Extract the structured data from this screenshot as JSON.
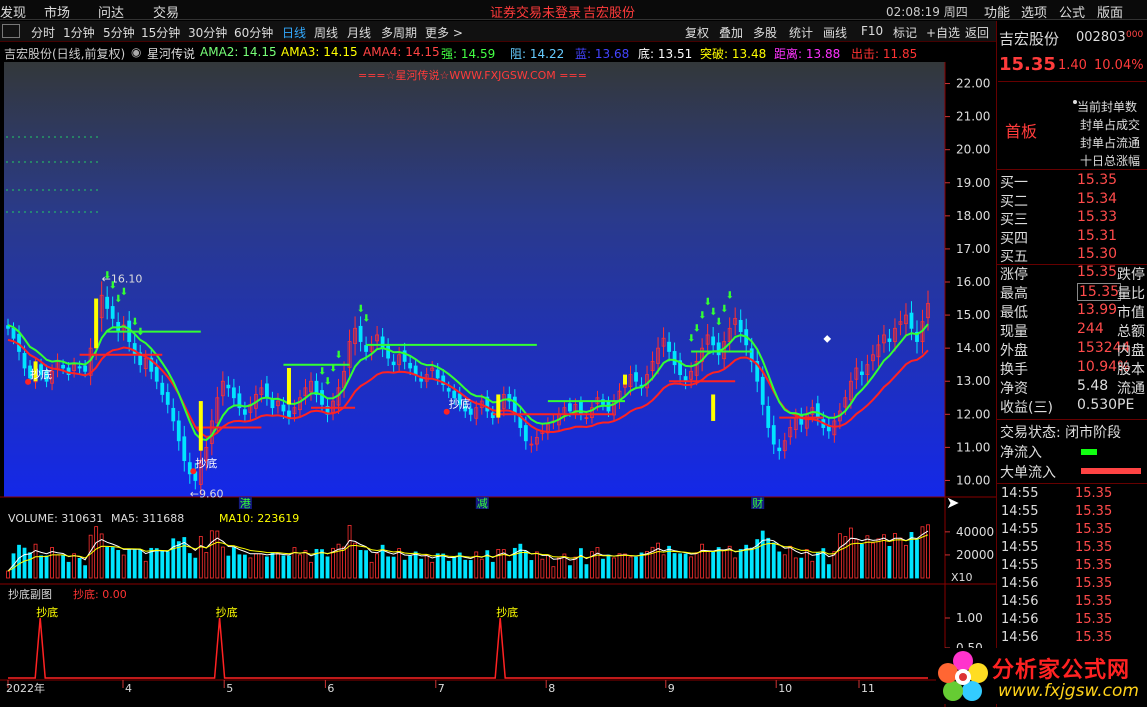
{
  "menu": {
    "items": [
      "发现",
      "市场",
      "问达",
      "交易"
    ],
    "warn": "证券交易未登录",
    "stock": "吉宏股份",
    "clock": "02:08:19 周四",
    "right": [
      "功能",
      "选项",
      "公式",
      "版面"
    ],
    "win": [
      "−",
      "□",
      "×"
    ]
  },
  "toolbar": {
    "periods": [
      "分时",
      "1分钟",
      "5分钟",
      "15分钟",
      "30分钟",
      "60分钟",
      "日线",
      "周线",
      "月线",
      "多周期",
      "更多 >"
    ],
    "active": "日线",
    "tools": [
      "复权",
      "叠加",
      "多股",
      "统计",
      "画线",
      "F10",
      "标记",
      "+自选",
      "返回"
    ]
  },
  "info": {
    "name": "吉宏股份(日线,前复权)",
    "indicator": "星河传说",
    "ama2": "AMA2: 14.15",
    "ama3": "AMA3: 14.15",
    "ama4": "AMA4: 14.15",
    "qiang": "强: 14.59",
    "zu": "阻: 14.22",
    "lan": "蓝: 13.68",
    "di": "底: 13.51",
    "tupo": "突破: 13.48",
    "juli": "距离: 13.88",
    "chuji": "出击: 11.85"
  },
  "watermark": "===☆星河传说☆WWW.FXJGSW.COM ===",
  "chart_data": [
    {
      "type": "candlestick",
      "title": "吉宏股份(日线,前复权)",
      "ylim": [
        9.5,
        22.5
      ],
      "yticks": [
        10,
        11,
        12,
        13,
        14,
        15,
        16,
        17,
        18,
        19,
        20,
        21,
        22
      ],
      "ytick_labels": [
        "10.00",
        "11.00",
        "12.00",
        "13.00",
        "14.00",
        "15.00",
        "16.00",
        "17.00",
        "18.00",
        "19.00",
        "20.00",
        "21.00",
        "22.00"
      ],
      "high_label": "16.10",
      "low_label": "9.60",
      "signal_label": "抄底",
      "markers": [
        "港",
        "减",
        "财"
      ],
      "close": [
        14.6,
        14.3,
        13.9,
        13.4,
        13.1,
        13.5,
        13.2,
        13.0,
        13.3,
        13.6,
        13.4,
        13.2,
        13.5,
        13.4,
        13.3,
        14.0,
        14.8,
        15.6,
        15.2,
        14.9,
        14.5,
        14.7,
        14.2,
        13.8,
        13.5,
        13.7,
        13.3,
        13.0,
        12.6,
        12.3,
        11.8,
        11.2,
        10.6,
        10.2,
        10.0,
        10.6,
        11.0,
        11.8,
        12.5,
        13.0,
        12.8,
        12.5,
        12.2,
        12.0,
        12.3,
        12.6,
        12.8,
        12.5,
        12.2,
        12.4,
        12.1,
        11.9,
        12.2,
        12.5,
        12.8,
        13.0,
        12.6,
        12.3,
        12.0,
        12.4,
        12.8,
        13.3,
        14.2,
        14.6,
        14.2,
        13.9,
        14.1,
        14.4,
        14.0,
        13.7,
        13.5,
        13.8,
        13.6,
        13.4,
        13.2,
        13.0,
        13.2,
        13.4,
        13.1,
        12.9,
        12.7,
        12.5,
        12.3,
        12.1,
        12.0,
        12.2,
        12.4,
        12.1,
        11.9,
        12.3,
        12.6,
        12.4,
        12.0,
        11.6,
        11.2,
        11.1,
        11.3,
        11.5,
        11.7,
        11.8,
        12.0,
        12.2,
        12.1,
        12.3,
        12.0,
        11.9,
        12.2,
        12.5,
        12.3,
        12.1,
        12.4,
        12.7,
        12.9,
        13.2,
        13.0,
        12.8,
        13.2,
        13.6,
        14.0,
        14.3,
        13.9,
        13.5,
        13.2,
        13.0,
        13.3,
        13.6,
        14.0,
        14.4,
        14.1,
        13.8,
        14.2,
        14.6,
        14.9,
        14.5,
        14.1,
        13.6,
        13.0,
        12.3,
        11.6,
        11.1,
        10.9,
        11.2,
        11.6,
        11.9,
        11.7,
        12.0,
        12.2,
        11.9,
        11.6,
        11.5,
        11.8,
        12.1,
        12.5,
        13.0,
        13.4,
        13.2,
        13.5,
        13.8,
        14.1,
        14.4,
        14.2,
        14.6,
        14.8,
        15.0,
        14.6,
        14.2,
        14.8,
        15.35
      ],
      "amp": [
        0.35,
        0.3,
        0.45,
        0.4,
        0.3,
        0.35,
        0.3,
        0.3,
        0.35,
        0.4,
        0.3,
        0.3,
        0.35,
        0.3,
        0.3,
        0.5,
        0.6,
        0.7,
        0.55,
        0.5,
        0.5,
        0.45,
        0.5,
        0.45,
        0.4,
        0.4,
        0.4,
        0.4,
        0.4,
        0.45,
        0.5,
        0.5,
        0.55,
        0.5,
        0.45,
        0.55,
        0.5,
        0.6,
        0.55,
        0.5,
        0.45,
        0.45,
        0.4,
        0.4,
        0.4,
        0.45,
        0.4,
        0.4,
        0.4,
        0.4,
        0.4,
        0.35,
        0.4,
        0.4,
        0.45,
        0.45,
        0.4,
        0.4,
        0.4,
        0.4,
        0.45,
        0.5,
        0.6,
        0.6,
        0.5,
        0.45,
        0.45,
        0.45,
        0.45,
        0.4,
        0.4,
        0.4,
        0.4,
        0.35,
        0.35,
        0.35,
        0.35,
        0.35,
        0.35,
        0.35,
        0.35,
        0.35,
        0.35,
        0.35,
        0.35,
        0.35,
        0.35,
        0.35,
        0.35,
        0.4,
        0.4,
        0.4,
        0.4,
        0.45,
        0.45,
        0.4,
        0.35,
        0.35,
        0.35,
        0.35,
        0.35,
        0.35,
        0.3,
        0.3,
        0.3,
        0.3,
        0.3,
        0.35,
        0.3,
        0.3,
        0.35,
        0.4,
        0.4,
        0.45,
        0.4,
        0.4,
        0.45,
        0.5,
        0.55,
        0.55,
        0.5,
        0.45,
        0.4,
        0.4,
        0.45,
        0.5,
        0.5,
        0.55,
        0.5,
        0.5,
        0.5,
        0.55,
        0.55,
        0.55,
        0.55,
        0.55,
        0.55,
        0.55,
        0.5,
        0.5,
        0.45,
        0.4,
        0.4,
        0.45,
        0.4,
        0.4,
        0.4,
        0.4,
        0.4,
        0.4,
        0.4,
        0.4,
        0.4,
        0.45,
        0.5,
        0.55,
        0.5,
        0.5,
        0.5,
        0.5,
        0.5,
        0.5,
        0.55,
        0.6,
        0.6,
        0.6,
        0.6,
        0.65,
        0.7
      ]
    },
    {
      "type": "bar",
      "title": "VOLUME",
      "label": "VOLUME: 310631",
      "ma5": "MA5: 311688",
      "ma10": "MA10: 223619",
      "yticks": [
        20000,
        40000
      ],
      "ytick_labels": [
        "20000",
        "40000"
      ],
      "unit": "X10",
      "ylim": [
        0,
        52000
      ]
    },
    {
      "type": "line",
      "title": "抄底副图",
      "label": "抄底副图",
      "value_label": "抄底: 0.00",
      "ylim": [
        0,
        1.2
      ],
      "yticks": [
        0.5,
        1.0
      ],
      "ytick_labels": [
        "0.50",
        "1.00"
      ],
      "peak_label": "抄底",
      "peak_positions": [
        0.035,
        0.23,
        0.535
      ]
    }
  ],
  "xaxis": {
    "labels": [
      "2022年",
      "4",
      "5",
      "6",
      "7",
      "8",
      "9",
      "10",
      "11"
    ],
    "positions": [
      0.0,
      0.125,
      0.235,
      0.345,
      0.465,
      0.585,
      0.715,
      0.835,
      0.925
    ]
  },
  "quote": {
    "name": "吉宏股份",
    "code": "002803",
    "price": "15.35",
    "change": "1.40",
    "pct": "10.04%",
    "board": "首板",
    "seal": [
      "当前封单数",
      "封单占成交",
      "封单占流通",
      "十日总涨幅"
    ],
    "bid": [
      {
        "l": "买一",
        "v": "15.35"
      },
      {
        "l": "买二",
        "v": "15.34"
      },
      {
        "l": "买三",
        "v": "15.33"
      },
      {
        "l": "买四",
        "v": "15.31"
      },
      {
        "l": "买五",
        "v": "15.30"
      }
    ],
    "stats": [
      {
        "l": "涨停",
        "v": "15.35",
        "x": "跌停"
      },
      {
        "l": "最高",
        "v": "15.35",
        "x": "量比"
      },
      {
        "l": "最低",
        "v": "13.99",
        "x": "市值"
      },
      {
        "l": "现量",
        "v": "244",
        "x": "总额"
      },
      {
        "l": "外盘",
        "v": "153244",
        "x": "内盘"
      },
      {
        "l": "换手",
        "v": "10.94%",
        "x": "股本"
      },
      {
        "l": "净资",
        "v": "5.48",
        "x": "流通"
      },
      {
        "l": "收益(三)",
        "v": "0.530",
        "x": "PE"
      }
    ],
    "status": "交易状态: 闭市阶段",
    "netin": "净流入",
    "bigin": "大单流入",
    "ticks": [
      {
        "t": "14:55",
        "p": "15.35"
      },
      {
        "t": "14:55",
        "p": "15.35"
      },
      {
        "t": "14:55",
        "p": "15.35"
      },
      {
        "t": "14:55",
        "p": "15.35"
      },
      {
        "t": "14:55",
        "p": "15.35"
      },
      {
        "t": "14:56",
        "p": "15.35"
      },
      {
        "t": "14:56",
        "p": "15.35"
      },
      {
        "t": "14:56",
        "p": "15.35"
      },
      {
        "t": "14:56",
        "p": "15.35"
      }
    ]
  },
  "logo": {
    "text": "分析家公式网",
    "url": "www.fxjgsw.com"
  }
}
